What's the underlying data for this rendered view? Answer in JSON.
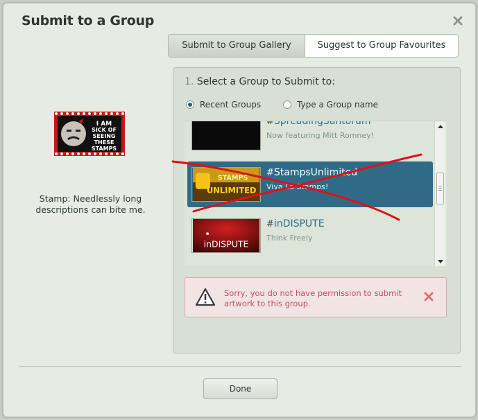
{
  "dialog": {
    "title": "Submit to a Group",
    "close_icon": "close-icon"
  },
  "tabs": [
    {
      "label": "Submit to Group Gallery",
      "active": true
    },
    {
      "label": "Suggest to Group Favourites",
      "active": false
    }
  ],
  "deviation": {
    "stamp_text": "I AM SICK OF SEEING THESE STAMPS",
    "caption": "Stamp: Needlessly long descriptions can bite me."
  },
  "step": {
    "number": "1.",
    "title": "Select a Group to Submit to:"
  },
  "radio_options": [
    {
      "label": "Recent Groups",
      "checked": true
    },
    {
      "label": "Type a Group name",
      "checked": false
    }
  ],
  "groups": [
    {
      "hash": "#",
      "name": "SpreadingSantorum",
      "desc": "Now featuring Mitt Romney!",
      "thumb_text": "",
      "selected": false
    },
    {
      "hash": "#",
      "name": "StampsUnlimited",
      "desc": "Viva La Stamps!",
      "thumb_text": "STAMPS UNLIMITED",
      "selected": true
    },
    {
      "hash": "#",
      "name": "inDISPUTE",
      "desc": "Think Freely",
      "thumb_text": "inDISPUTE",
      "selected": false
    }
  ],
  "error": {
    "icon": "warning-icon",
    "message": "Sorry, you do not have permission to submit artwork to this group."
  },
  "footer": {
    "done_label": "Done"
  },
  "colors": {
    "selected_row": "#2f6b87",
    "group_name": "#2a6d8a",
    "error_text": "#c0505f",
    "annotation_red": "#e0101a"
  }
}
